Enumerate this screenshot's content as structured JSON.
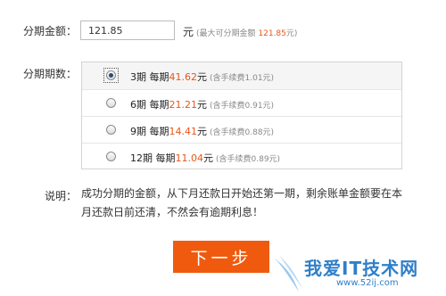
{
  "amount": {
    "label": "分期金额：",
    "value": "121.85",
    "unit": "元",
    "hint_prefix": "(最大可分期金额",
    "hint_max": "121.85",
    "hint_suffix": "元)"
  },
  "term": {
    "label": "分期期数：",
    "options": [
      {
        "periods": "3期",
        "per_label": "每期",
        "amount": "41.62",
        "unit": "元",
        "fee": "(含手续费1.01元)",
        "selected": true
      },
      {
        "periods": "6期",
        "per_label": "每期",
        "amount": "21.21",
        "unit": "元",
        "fee": "(含手续费0.91元)",
        "selected": false
      },
      {
        "periods": "9期",
        "per_label": "每期",
        "amount": "14.41",
        "unit": "元",
        "fee": "(含手续费0.88元)",
        "selected": false
      },
      {
        "periods": "12期",
        "per_label": "每期",
        "amount": "11.04",
        "unit": "元",
        "fee": "(含手续费0.89元)",
        "selected": false
      }
    ]
  },
  "note": {
    "label": "说明：",
    "text": "成功分期的金额，从下月还款日开始还第一期，剩余账单金额要在本月还款日前还清，不然会有逾期利息！"
  },
  "next_button": {
    "label": "下一步"
  },
  "watermark": {
    "title": "我爱IT技术网",
    "url": "www.52ij.com"
  },
  "colors": {
    "accent": "#e8561a",
    "button": "#f05a0f",
    "watermark": "#2f7fc9"
  }
}
